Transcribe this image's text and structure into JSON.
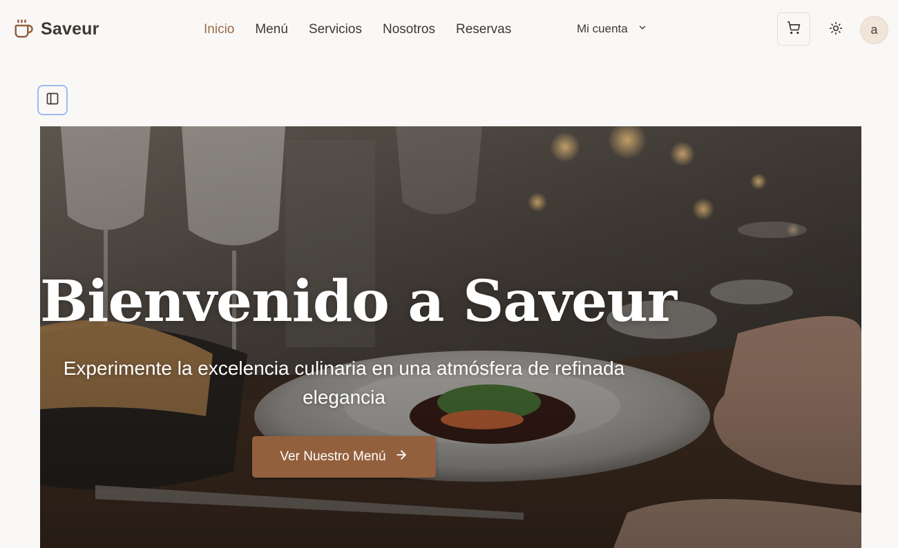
{
  "brand": {
    "name": "Saveur",
    "icon": "coffee-cup-icon",
    "accent": "#93603d"
  },
  "nav": {
    "items": [
      {
        "label": "Inicio",
        "active": true
      },
      {
        "label": "Menú",
        "active": false
      },
      {
        "label": "Servicios",
        "active": false
      },
      {
        "label": "Nosotros",
        "active": false
      },
      {
        "label": "Reservas",
        "active": false
      }
    ],
    "account_label": "Mi cuenta"
  },
  "header_actions": {
    "cart_icon": "shopping-cart-icon",
    "theme_icon": "sun-icon",
    "avatar_initial": "a"
  },
  "sidebar_toggle": {
    "icon": "panel-left-icon"
  },
  "hero": {
    "title": "Bienvenido a Saveur",
    "subtitle": "Experimente la excelencia culinaria en una atmósfera de refinada elegancia",
    "cta_label": "Ver Nuestro Menú",
    "cta_icon": "arrow-right-icon"
  }
}
